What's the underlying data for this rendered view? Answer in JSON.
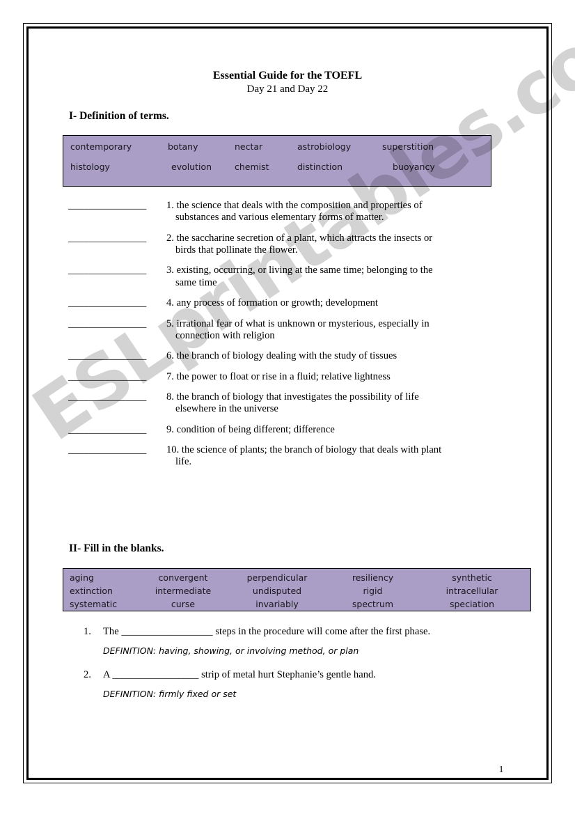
{
  "document": {
    "title_main": "Essential Guide for the TOEFL",
    "title_sub": "Day 21 and Day 22",
    "page_number": "1",
    "watermark": "ESLprintables.com",
    "accent_color": "#ab9ec6",
    "border_color": "#000000"
  },
  "section1": {
    "heading": "I- Definition of terms.",
    "wordbank": {
      "rows": [
        [
          "contemporary",
          "botany",
          "nectar",
          "astrobiology",
          "superstition"
        ],
        [
          "histology",
          "evolution",
          "chemist",
          "distinction",
          "buoyancy"
        ]
      ]
    },
    "blank_line": "_______________",
    "items": [
      {
        "number": "1.",
        "line1": "1. the science that deals with the composition and properties of",
        "line2": "substances and various elementary forms of matter."
      },
      {
        "number": "2.",
        "line1": "2. the saccharine secretion of a plant, which attracts the insects or",
        "line2": "birds that pollinate the flower."
      },
      {
        "number": "3.",
        "line1": "3. existing, occurring, or living at the same time; belonging to the",
        "line2": "same time"
      },
      {
        "number": "4.",
        "line1": "4. any process of formation or growth; development",
        "line2": ""
      },
      {
        "number": "5.",
        "line1": "5. irrational fear of what is unknown or mysterious, especially in",
        "line2": "connection with religion"
      },
      {
        "number": "6.",
        "line1": "6. the branch of biology dealing with the study of tissues",
        "line2": ""
      },
      {
        "number": "7.",
        "line1": "7. the power to float or rise in a fluid; relative lightness",
        "line2": ""
      },
      {
        "number": "8.",
        "line1": "8.  the branch of biology that investigates the possibility of life",
        "line2": "elsewhere in the universe"
      },
      {
        "number": "9.",
        "line1": "9. condition of being different; difference",
        "line2": ""
      },
      {
        "number": "10.",
        "line1": "10. the science of plants; the branch of biology that deals with plant",
        "line2": "life."
      }
    ]
  },
  "section2": {
    "heading": "II- Fill in the blanks.",
    "wordbank": {
      "rows": [
        [
          "aging",
          "convergent",
          "perpendicular",
          "resiliency",
          "synthetic"
        ],
        [
          "extinction",
          "intermediate",
          "undisputed",
          "rigid",
          "intracellular"
        ],
        [
          "systematic",
          "curse",
          "invariably",
          "spectrum",
          "speciation"
        ]
      ]
    },
    "items": [
      {
        "number": "1.",
        "question": "The __________________ steps in the procedure will come after the first phase.",
        "definition": "DEFINITION: having, showing, or involving method, or plan"
      },
      {
        "number": "2.",
        "question": "A _________________ strip of metal hurt Stephanie’s gentle hand.",
        "definition": "DEFINITION: firmly fixed or set"
      }
    ]
  }
}
